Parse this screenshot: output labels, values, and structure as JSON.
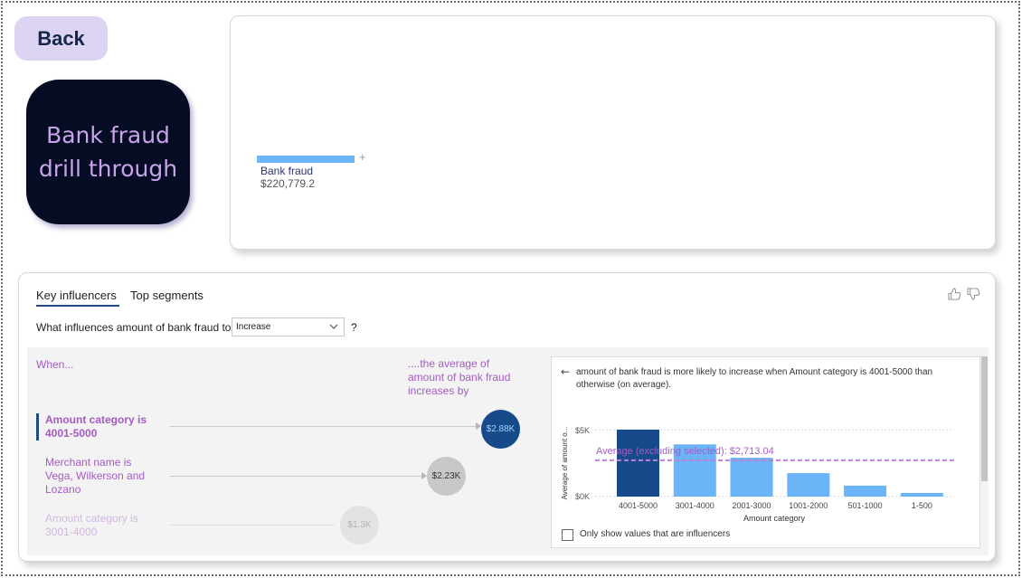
{
  "nav": {
    "back_label": "Back"
  },
  "title_card": {
    "text": "Bank fraud drill through"
  },
  "top_visual": {
    "bar_label": "Bank fraud",
    "bar_value": "$220,779.2",
    "expand_symbol": "+"
  },
  "key_influencers": {
    "tabs": [
      {
        "label": "Key influencers",
        "active": true
      },
      {
        "label": "Top segments",
        "active": false
      }
    ],
    "feedback_icons": [
      "thumbs-up-icon",
      "thumbs-down-icon"
    ],
    "question": "What influences amount of bank fraud to",
    "dropdown_value": "Increase",
    "question_mark": "?",
    "when_label": "When...",
    "avg_header": "....the average of amount of bank fraud increases by",
    "influencers": [
      {
        "label": "Amount category is 4001-5000",
        "value": "$2.88K",
        "state": "selected"
      },
      {
        "label": "Merchant name is Vega, Wilkerson and Lozano",
        "value": "$2.23K",
        "state": "normal"
      },
      {
        "label": "Amount category is 3001-4000",
        "value": "$1.3K",
        "state": "faded"
      }
    ],
    "colors": {
      "selected": "#164a8a",
      "bar": "#6ab4f7",
      "accent": "#a45bc4"
    }
  },
  "detail": {
    "back_arrow": "←",
    "description": "amount of bank fraud is more likely to increase when Amount category is 4001-5000 than otherwise (on average).",
    "checkbox_label": "Only show values that are influencers",
    "checkbox_checked": false
  },
  "chart_data": {
    "type": "bar",
    "categories": [
      "4001-5000",
      "3001-4000",
      "2001-3000",
      "1001-2000",
      "501-1000",
      "1-500"
    ],
    "values": [
      5000,
      3900,
      2900,
      1750,
      820,
      270
    ],
    "highlighted": "4001-5000",
    "xlabel": "Amount category",
    "ylabel": "Average of amount o...",
    "yticks": [
      "$0K",
      "$5K"
    ],
    "ylim": [
      0,
      5000
    ],
    "reference_line": {
      "label": "Average (excluding selected): $2,713.04",
      "value": 2713.04
    }
  }
}
